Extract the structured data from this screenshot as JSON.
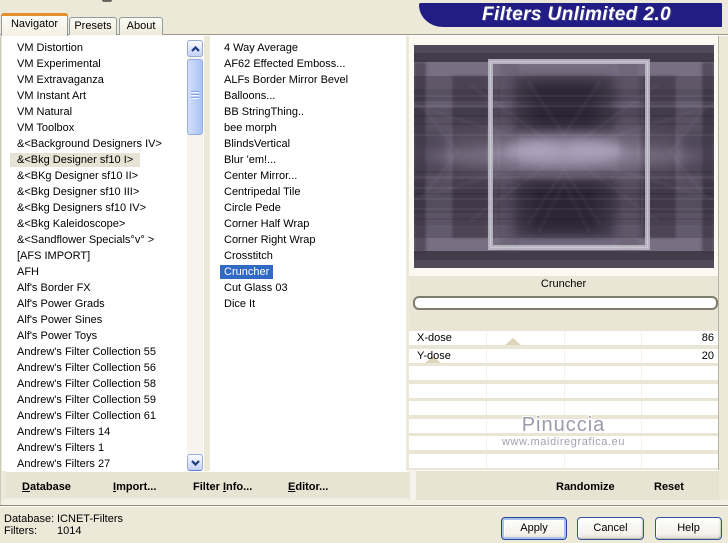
{
  "window": {
    "title": "Filters Unlimited 2.0"
  },
  "tabs": [
    {
      "label": "Navigator",
      "active": true
    },
    {
      "label": "Presets",
      "active": false
    },
    {
      "label": "About",
      "active": false
    }
  ],
  "category_list": {
    "selected_index": 7,
    "items": [
      "VM Distortion",
      "VM Experimental",
      "VM Extravaganza",
      "VM Instant Art",
      "VM Natural",
      "VM Toolbox",
      "&<Background Designers IV>",
      "&<Bkg Designer sf10 I>",
      "&<BKg Designer sf10 II>",
      "&<Bkg Designer sf10 III>",
      "&<Bkg Designers sf10 IV>",
      "&<Bkg Kaleidoscope>",
      "&<Sandflower Specials°v° >",
      "[AFS IMPORT]",
      "AFH",
      "Alf's Border FX",
      "Alf's Power Grads",
      "Alf's Power Sines",
      "Alf's Power Toys",
      "Andrew's Filter Collection 55",
      "Andrew's Filter Collection 56",
      "Andrew's Filter Collection 58",
      "Andrew's Filter Collection 59",
      "Andrew's Filter Collection 61",
      "Andrew's Filters 14",
      "Andrew's Filters 1",
      "Andrew's Filters 27"
    ]
  },
  "filter_list": {
    "selected_index": 14,
    "items": [
      "4 Way Average",
      "AF62 Effected Emboss...",
      "ALFs Border Mirror Bevel",
      "Balloons...",
      "BB StringThing..",
      "bee morph",
      "BlindsVertical",
      "Blur 'em!...",
      "Center Mirror...",
      "Centripedal Tile",
      "Circle Pede",
      "Corner Half Wrap",
      "Corner Right Wrap",
      "Crosstitch",
      "Cruncher",
      "Cut Glass 03",
      "Dice It"
    ]
  },
  "preview": {
    "filter_name": "Cruncher",
    "progress_value": 0
  },
  "parameters": [
    {
      "label": "X-dose",
      "value": 86,
      "max": 255
    },
    {
      "label": "Y-dose",
      "value": 20,
      "max": 255
    }
  ],
  "empty_param_rows": 6,
  "watermark": {
    "line1": "Pinuccia",
    "line2": "www.maidiregrafica.eu"
  },
  "toolbar": {
    "database": {
      "text": "Database",
      "u": 0
    },
    "import": {
      "text": "Import...",
      "u": 0
    },
    "filter_info": {
      "text": "Filter Info...",
      "u": 7
    },
    "editor": {
      "text": "Editor...",
      "u": 0
    },
    "randomize": {
      "text": "Randomize",
      "u": -1
    },
    "reset": {
      "text": "Reset",
      "u": -1
    }
  },
  "status": {
    "database_label": "Database:",
    "database_value": "ICNET-Filters",
    "filters_label": "Filters:",
    "filters_value": "1014"
  },
  "action_buttons": {
    "apply": "Apply",
    "cancel": "Cancel",
    "help": "Help"
  },
  "colors": {
    "dialog_bg": "#ece9d8",
    "banner": "#211d84",
    "selection_blue": "#316ac5",
    "inactive_selection": "#e6e3d4",
    "tab_highlight_orange": "#e5902e",
    "param_bg": "#eae6d5"
  }
}
